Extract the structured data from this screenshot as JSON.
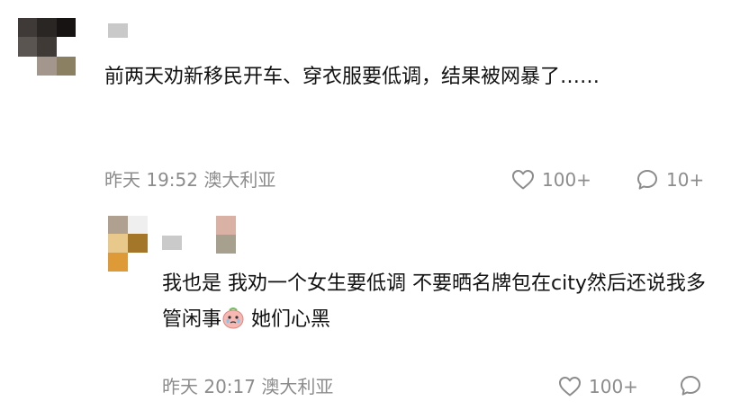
{
  "comments": [
    {
      "text": "前两天劝新移民开车、穿衣服要低调，结果被网暴了……",
      "date": "昨天 19:52",
      "location": "澳大利亚",
      "likes": "100+",
      "replies": "10+"
    }
  ],
  "reply": {
    "text_before_emoji": "我也是 我劝一个女生要低调 不要晒名牌包在city然后还说我多管闲事",
    "text_after_emoji": " 她们心黑",
    "date": "昨天 20:17",
    "location": "澳大利亚",
    "likes": "100+"
  },
  "colors": {
    "text": "#111111",
    "meta": "#8c8c8c",
    "avatar_main": [
      "#3f3a38",
      "#2a2623",
      "#161312",
      "#5b5552",
      "#3f3a36",
      "#ffffff",
      "#ffffff",
      "#a3978d",
      "#8c8063"
    ],
    "avatar_reply": [
      "#b0a090",
      "#efefef",
      "#e8c98b",
      "#a4762a",
      "#df9a38",
      "#ffffff"
    ],
    "name_main": [
      "#c9c9c9"
    ],
    "name_reply": [
      "#cacaca"
    ],
    "name_reply_2": [
      "#d9b1a5",
      "#a8a08e"
    ]
  }
}
